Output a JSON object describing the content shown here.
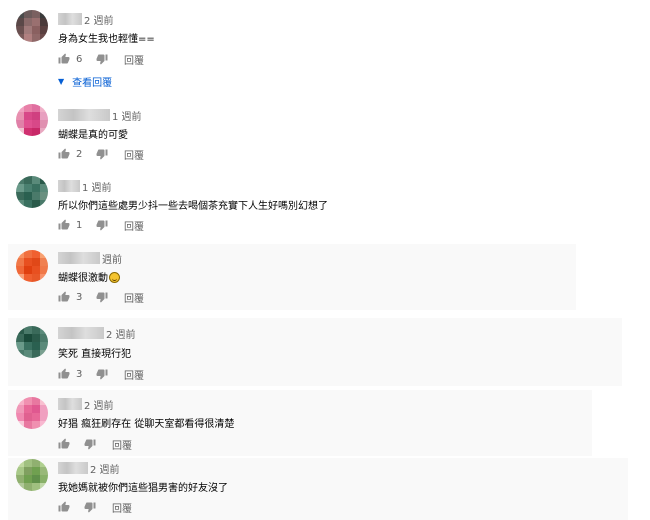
{
  "comments": [
    {
      "time": "2 週前",
      "text": "身為女生我也輕懂==",
      "likes": "6",
      "reply_label": "回覆",
      "view_replies": "查看回覆"
    },
    {
      "time": "1 週前",
      "text": "蝴蝶是真的可愛",
      "likes": "2",
      "reply_label": "回覆"
    },
    {
      "time": "1 週前",
      "text": "所以你們這些處男少抖一些去喝個茶充實下人生好嗎別幻想了",
      "likes": "1",
      "reply_label": "回覆"
    },
    {
      "time": "週前",
      "text": "蝴蝶很激動",
      "likes": "3",
      "reply_label": "回覆"
    },
    {
      "time": "2 週前",
      "text": "笑死 直接現行犯",
      "likes": "3",
      "reply_label": "回覆"
    },
    {
      "time": "2 週前",
      "text": "好猖 瘋狂刷存在 從聊天室都看得很清楚",
      "likes": "",
      "reply_label": "回覆"
    },
    {
      "time": "2 週前",
      "text": "我她媽就被你們這些猖男害的好友沒了",
      "likes": "",
      "reply_label": "回覆"
    }
  ],
  "colors": {
    "meta_text": "#606060",
    "link_blue": "#065fd4",
    "highlight_panel": "#f9f9f9"
  },
  "icons": [
    "thumb-up-icon",
    "thumb-down-icon",
    "caret-down-icon",
    "grin-emoji-icon"
  ]
}
